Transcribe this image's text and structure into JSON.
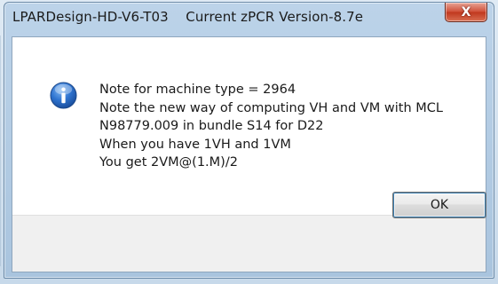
{
  "window": {
    "title": "LPARDesign-HD-V6-T03    Current zPCR Version-8.7e",
    "close_glyph": "X"
  },
  "dialog": {
    "icon": "information-icon",
    "message_lines": [
      "Note for machine type = 2964",
      "Note the new way of computing VH and VM with MCL",
      "N98779.009 in bundle S14 for D22",
      "When you have 1VH and 1VM",
      "You get 2VM@(1.M)/2"
    ],
    "ok_label": "OK"
  },
  "colors": {
    "close_button": "#c7472d",
    "info_icon": "#2a6dc4",
    "titlebar": "#bcd3e9"
  }
}
